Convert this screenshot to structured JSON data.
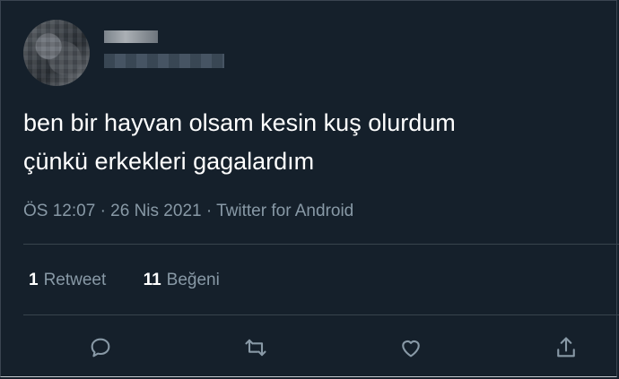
{
  "tweet": {
    "text_line1": "ben bir hayvan olsam kesin kuş olurdum",
    "text_line2": "çünkü erkekleri gagalardım",
    "time": "ÖS 12:07",
    "separator": "·",
    "date": "26 Nis 2021",
    "source": "Twitter for Android"
  },
  "stats": {
    "retweet_count": "1",
    "retweet_label": "Retweet",
    "like_count": "11",
    "like_label": "Beğeni"
  },
  "actions": {
    "icons": [
      "reply-icon",
      "retweet-icon",
      "like-icon",
      "share-icon"
    ]
  },
  "colors": {
    "background": "#15202b",
    "text": "#ffffff",
    "secondary": "#8899a6",
    "divider": "#38444d"
  }
}
